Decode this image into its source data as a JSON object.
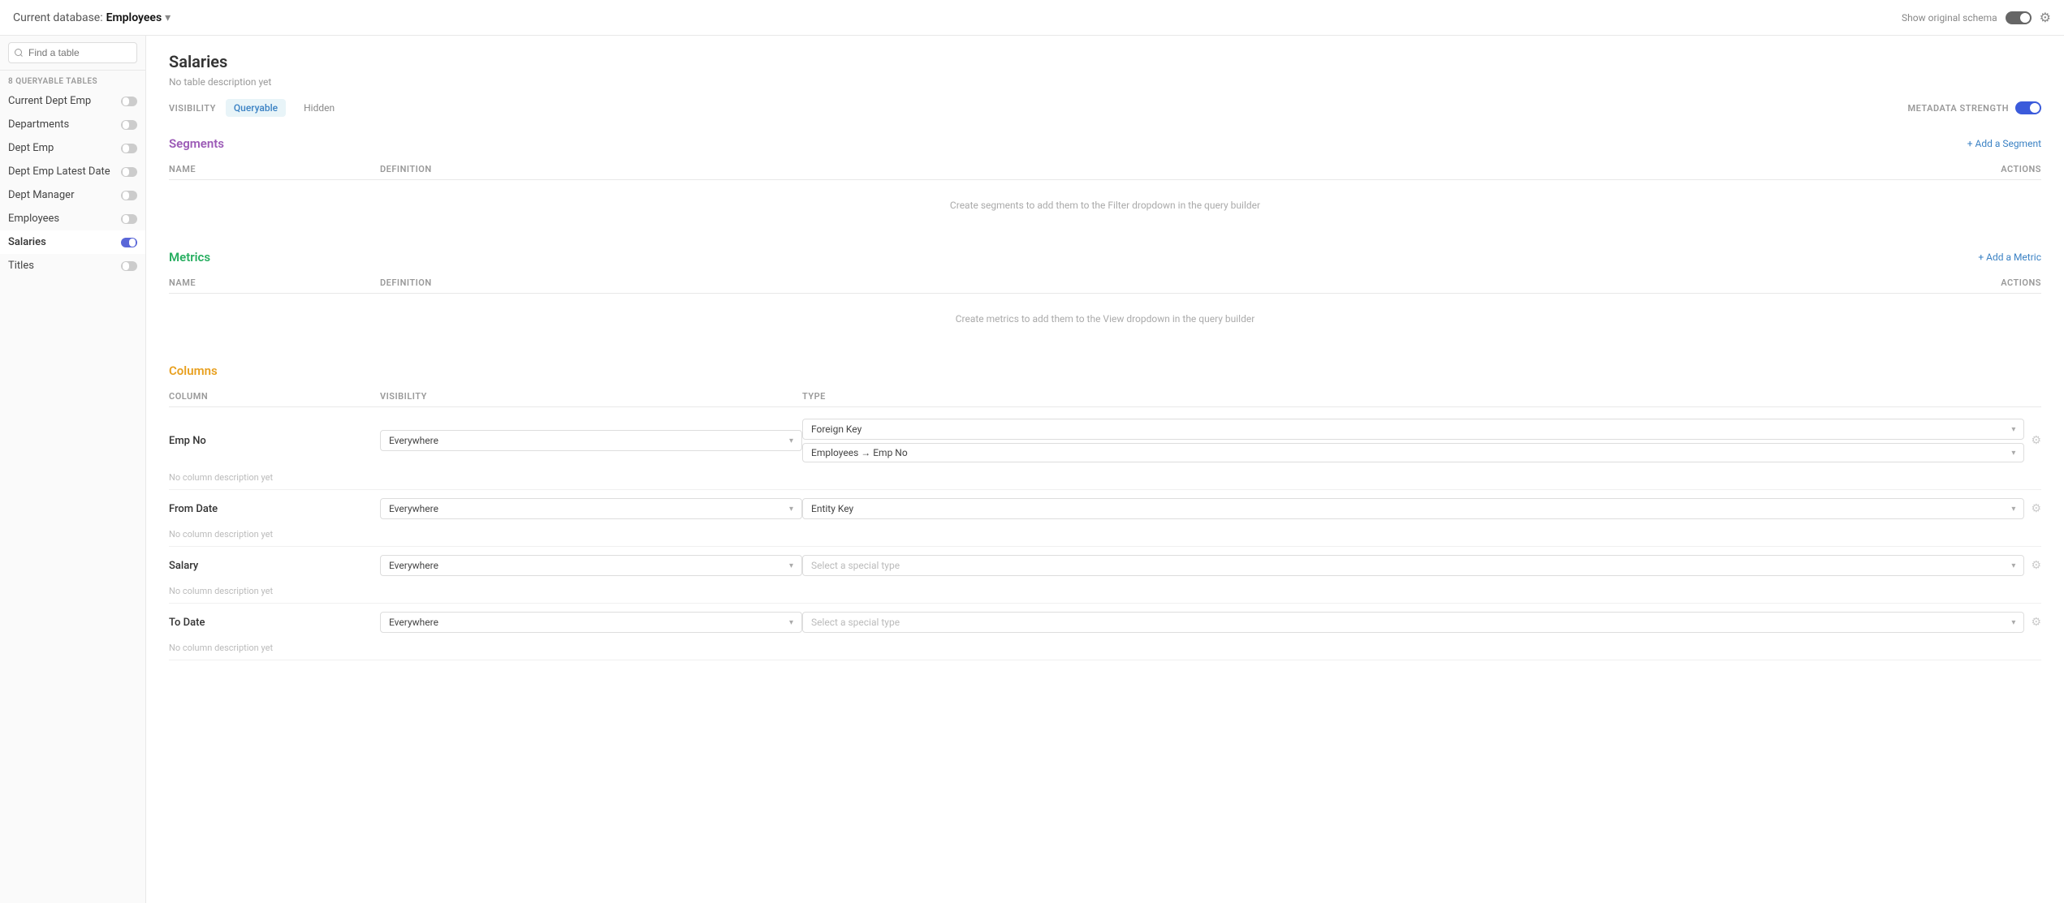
{
  "topbar": {
    "db_prefix": "Current database:",
    "db_name": "Employees",
    "show_original_label": "Show original schema",
    "gear_icon": "⚙"
  },
  "sidebar": {
    "search_placeholder": "Find a table",
    "section_label": "8 QUERYABLE TABLES",
    "items": [
      {
        "id": "current-dept-emp",
        "label": "Current Dept Emp",
        "active": false,
        "toggled": false
      },
      {
        "id": "departments",
        "label": "Departments",
        "active": false,
        "toggled": false
      },
      {
        "id": "dept-emp",
        "label": "Dept Emp",
        "active": false,
        "toggled": false
      },
      {
        "id": "dept-emp-latest-date",
        "label": "Dept Emp Latest Date",
        "active": false,
        "toggled": false
      },
      {
        "id": "dept-manager",
        "label": "Dept Manager",
        "active": false,
        "toggled": false
      },
      {
        "id": "employees",
        "label": "Employees",
        "active": false,
        "toggled": false
      },
      {
        "id": "salaries",
        "label": "Salaries",
        "active": true,
        "toggled": true
      },
      {
        "id": "titles",
        "label": "Titles",
        "active": false,
        "toggled": false
      }
    ]
  },
  "content": {
    "title": "Salaries",
    "subtitle": "No table description yet",
    "visibility": {
      "label": "VISIBILITY",
      "tabs": [
        {
          "label": "Queryable",
          "active": true
        },
        {
          "label": "Hidden",
          "active": false
        }
      ]
    },
    "metadata": {
      "label": "METADATA STRENGTH"
    },
    "segments": {
      "title": "Segments",
      "add_label": "+ Add a Segment",
      "name_col": "NAME",
      "definition_col": "DEFINITION",
      "actions_col": "ACTIONS",
      "empty_msg": "Create segments to add them to the Filter dropdown in the query builder"
    },
    "metrics": {
      "title": "Metrics",
      "add_label": "+ Add a Metric",
      "name_col": "NAME",
      "definition_col": "DEFINITION",
      "actions_col": "ACTIONS",
      "empty_msg": "Create metrics to add them to the View dropdown in the query builder"
    },
    "columns": {
      "title": "Columns",
      "col_header_column": "COLUMN",
      "col_header_visibility": "VISIBILITY",
      "col_header_type": "TYPE",
      "rows": [
        {
          "name": "Emp No",
          "visibility": "Everywhere",
          "type": "Foreign Key",
          "type_placeholder": false,
          "sub_type": "Employees → Emp No",
          "has_sub": true,
          "description": "No column description yet"
        },
        {
          "name": "From Date",
          "visibility": "Everywhere",
          "type": "Entity Key",
          "type_placeholder": false,
          "has_sub": false,
          "description": "No column description yet"
        },
        {
          "name": "Salary",
          "visibility": "Everywhere",
          "type": "Select a special type",
          "type_placeholder": true,
          "has_sub": false,
          "description": "No column description yet"
        },
        {
          "name": "To Date",
          "visibility": "Everywhere",
          "type": "Select a special type",
          "type_placeholder": true,
          "has_sub": false,
          "description": "No column description yet"
        }
      ]
    }
  }
}
